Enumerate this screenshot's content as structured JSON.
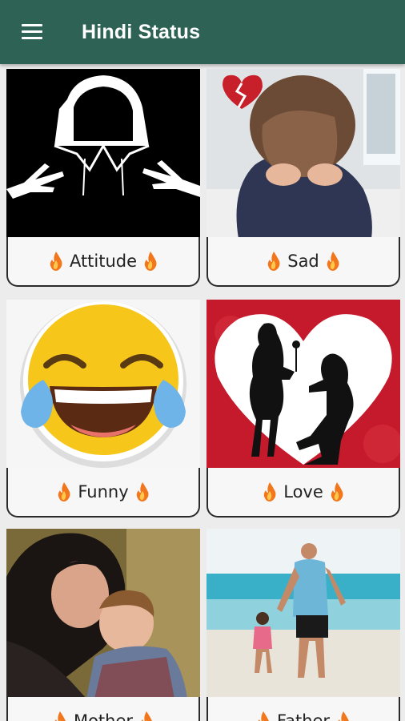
{
  "appbar": {
    "title": "Hindi Status",
    "menu_icon": "hamburger-menu-icon",
    "background": "#2e6255"
  },
  "categories": [
    {
      "label": "Attitude"
    },
    {
      "label": "Sad"
    },
    {
      "label": "Funny"
    },
    {
      "label": "Love"
    },
    {
      "label": "Mother"
    },
    {
      "label": "Father"
    }
  ],
  "label_icon": "fire-icon"
}
